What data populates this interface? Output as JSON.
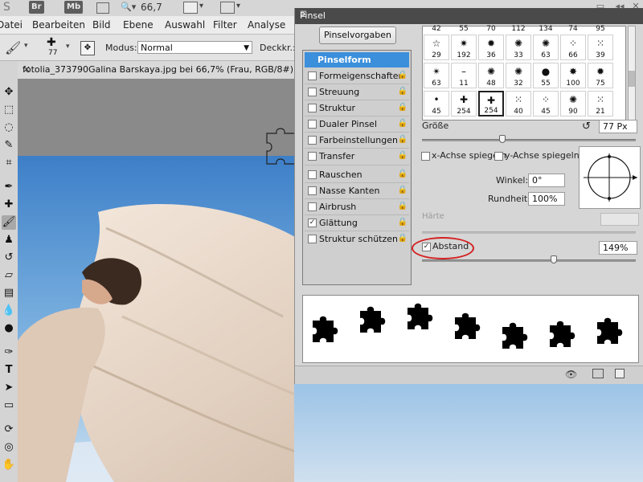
{
  "topbar": {
    "ps_label": "S",
    "badges": [
      "Br",
      "Mb"
    ],
    "zoom": "66,7"
  },
  "menu": [
    "Datei",
    "Bearbeiten",
    "Bild",
    "Ebene",
    "Auswahl",
    "Filter",
    "Analyse"
  ],
  "options": {
    "brush_size": "77",
    "mode_label": "Modus:",
    "mode_value": "Normal",
    "opacity_label": "Deckkr.:"
  },
  "document": {
    "tab_title": "fotolia_373790Galina Barskaya.jpg bei 66,7% (Frau, RGB/8#) *",
    "close": "×"
  },
  "panel": {
    "title": "Pinsel",
    "presets_button": "Pinselvorgaben",
    "sections": [
      {
        "label": "Pinselform",
        "checked": null,
        "selected": true
      },
      {
        "label": "Formeigenschaften",
        "checked": false
      },
      {
        "label": "Streuung",
        "checked": false
      },
      {
        "label": "Struktur",
        "checked": false
      },
      {
        "label": "Dualer Pinsel",
        "checked": false
      },
      {
        "label": "Farbeinstellungen",
        "checked": false
      },
      {
        "label": "Transfer",
        "checked": false
      },
      {
        "label": "Rauschen",
        "checked": false
      },
      {
        "label": "Nasse Kanten",
        "checked": false
      },
      {
        "label": "Airbrush",
        "checked": false
      },
      {
        "label": "Glättung",
        "checked": true
      },
      {
        "label": "Struktur schützen",
        "checked": false
      }
    ],
    "brush_top_numbers": [
      "42",
      "55",
      "70",
      "112",
      "134",
      "74",
      "95"
    ],
    "brush_tips": [
      {
        "glyph": "☆",
        "num": "29"
      },
      {
        "glyph": "✷",
        "num": "192"
      },
      {
        "glyph": "✹",
        "num": "36"
      },
      {
        "glyph": "✺",
        "num": "33"
      },
      {
        "glyph": "✺",
        "num": "63"
      },
      {
        "glyph": "⁘",
        "num": "66"
      },
      {
        "glyph": "⁙",
        "num": "39"
      },
      {
        "glyph": "✴",
        "num": "63"
      },
      {
        "glyph": "–",
        "num": "11"
      },
      {
        "glyph": "✺",
        "num": "48"
      },
      {
        "glyph": "✺",
        "num": "32"
      },
      {
        "glyph": "●",
        "num": "55"
      },
      {
        "glyph": "✸",
        "num": "100"
      },
      {
        "glyph": "✹",
        "num": "75"
      },
      {
        "glyph": "•",
        "num": "45"
      },
      {
        "glyph": "✚",
        "num": "254"
      },
      {
        "glyph": "✚",
        "num": "254",
        "selected": true
      },
      {
        "glyph": "⁙",
        "num": "40"
      },
      {
        "glyph": "⁘",
        "num": "45"
      },
      {
        "glyph": "✺",
        "num": "90"
      },
      {
        "glyph": "⁙",
        "num": "21"
      }
    ],
    "size_label": "Größe",
    "size_value": "77 Px",
    "flip_x_label": "x-Achse spiegeln",
    "flip_y_label": "y-Achse spiegeln",
    "angle_label": "Winkel:",
    "angle_value": "0°",
    "roundness_label": "Rundheit:",
    "roundness_value": "100%",
    "hardness_label": "Härte",
    "spacing_label": "Abstand",
    "spacing_checked": true,
    "spacing_value": "149%"
  },
  "colors": {
    "sky": "#5e9ad3",
    "fabric": "#e8d9cc",
    "selection": "#3b8fdb",
    "highlight_ring": "#d42020"
  }
}
